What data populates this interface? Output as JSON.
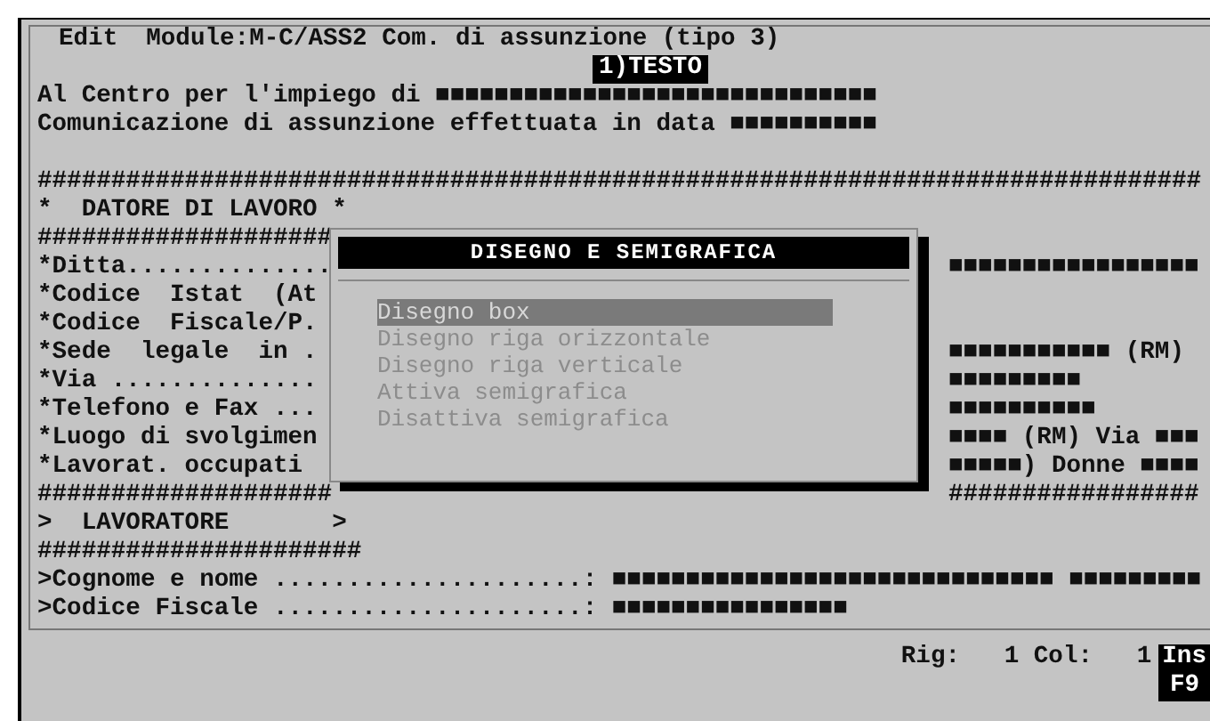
{
  "menu_bar": {
    "command": "Edit",
    "module": "Module:M-C/ASS2 Com. di assunzione (tipo 3)"
  },
  "section_badge": "1)TESTO",
  "address_lines": [
    "Al Centro per l'impiego di ■■■■■■■■■■■■■■■■■■■■■■■■■■■■■■",
    "Comunicazione di assunzione effettuata in data ■■■■■■■■■■"
  ],
  "lines": [
    {
      "left": "###############################################################################"
    },
    {
      "left": "*  DATORE DI LAVORO *"
    },
    {
      "left": "####################"
    },
    {
      "left": "*Ditta..............",
      "right": "■■■■■■■■■■■■■■■■■"
    },
    {
      "left": "*Codice  Istat  (At"
    },
    {
      "left": "*Codice  Fiscale/P."
    },
    {
      "left": "*Sede  legale  in .",
      "right": "■■■■■■■■■■■ (RM)"
    },
    {
      "left": "*Via ..............",
      "right": "■■■■■■■■■"
    },
    {
      "left": "*Telefono e Fax ...",
      "right": "■■■■■■■■■■"
    },
    {
      "left": "*Luogo di svolgimen",
      "right": "■■■■ (RM) Via ■■■"
    },
    {
      "left": "*Lavorat. occupati",
      "right": "■■■■■) Donne ■■■■"
    },
    {
      "left": "####################",
      "right": "#################"
    },
    {
      "left": ">  LAVORATORE       >"
    },
    {
      "left": "######################"
    },
    {
      "left": ">Cognome e nome .....................: ■■■■■■■■■■■■■■■■■■■■■■■■■■■■■■ ■■■■■■■■■"
    },
    {
      "left": ">Codice Fiscale .....................: ■■■■■■■■■■■■■■■■"
    }
  ],
  "dialog": {
    "title": "DISEGNO E SEMIGRAFICA",
    "items": [
      {
        "label": "Disegno box",
        "selected": true
      },
      {
        "label": "Disegno riga orizzontale",
        "selected": false
      },
      {
        "label": "Disegno riga verticale",
        "selected": false
      },
      {
        "label": "Attiva semigrafica",
        "selected": false
      },
      {
        "label": "Disattiva semigrafica",
        "selected": false
      }
    ]
  },
  "status_bar": {
    "position": "Rig:   1 Col:   1",
    "mode": "Ins",
    "key": "F9"
  }
}
